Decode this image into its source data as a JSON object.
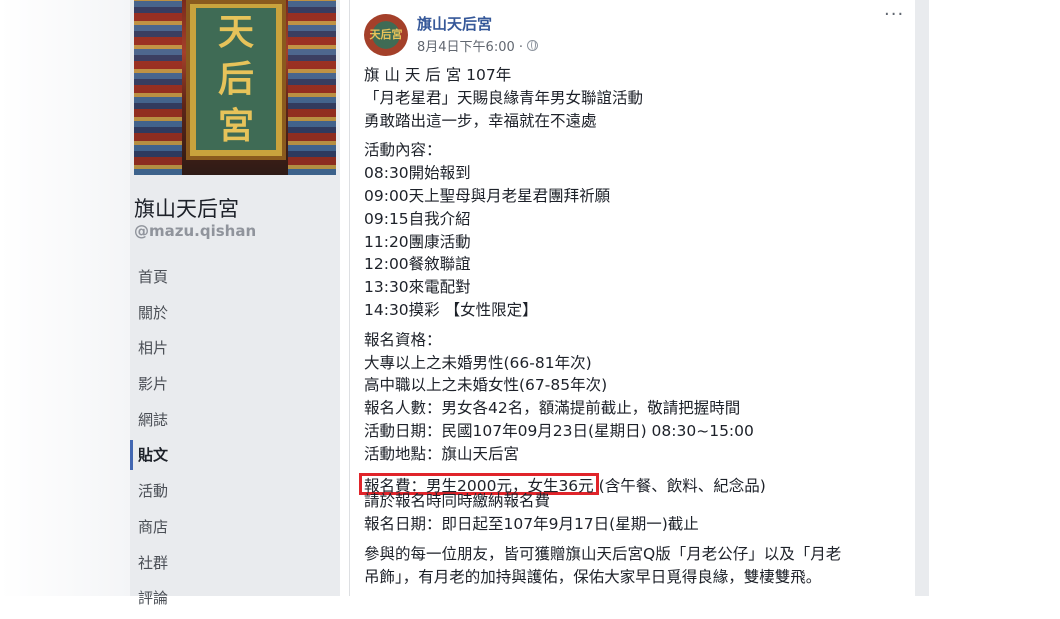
{
  "page": {
    "name": "旗山天后宮",
    "handle": "@mazu.qishan",
    "cover_board": [
      "天",
      "后",
      "宮"
    ],
    "avatar_text": "天后宮"
  },
  "nav": [
    "首頁",
    "關於",
    "相片",
    "影片",
    "網誌",
    "貼文",
    "活動",
    "商店",
    "社群",
    "評論"
  ],
  "post": {
    "author": "旗山天后宮",
    "timestamp": "8月4日下午6:00 ·",
    "more": "···",
    "intro": [
      "旗 山 天 后 宮 107年",
      "「月老星君」天賜良緣青年男女聯誼活動",
      "勇敢踏出這一步，幸福就在不遠處"
    ],
    "schedule": [
      "活動內容：",
      "08:30開始報到",
      "09:00天上聖母與月老星君團拜祈願",
      "09:15自我介紹",
      "11:20團康活動",
      "12:00餐敘聯誼",
      "13:30來電配對",
      "14:30摸彩 【女性限定】"
    ],
    "details": [
      "報名資格：",
      "大專以上之未婚男性(66-81年次)",
      "高中職以上之未婚女性(67-85年次)",
      "報名人數：男女各42名，額滿提前截止，敬請把握時間",
      "活動日期：民國107年09月23日(星期日) 08:30~15:00",
      "活動地點：旗山天后宮"
    ],
    "fee_highlight": "報名費：男生2000元，女生36元",
    "fee_rest": "(含午餐、飲料、紀念品)",
    "fee_note": "請於報名時同時繳納報名費",
    "deadline": "報名日期：即日起至107年9月17日(星期一)截止",
    "closing": [
      "參與的每一位朋友，皆可獲贈旗山天后宮Q版「月老公仔」以及「月老",
      "吊飾」，有月老的加持與護佑，保佑大家早日覓得良緣，雙棲雙飛。"
    ]
  },
  "colors": {
    "link": "#365899",
    "highlight_border": "#e0242a",
    "active_nav": "#4267b2"
  }
}
